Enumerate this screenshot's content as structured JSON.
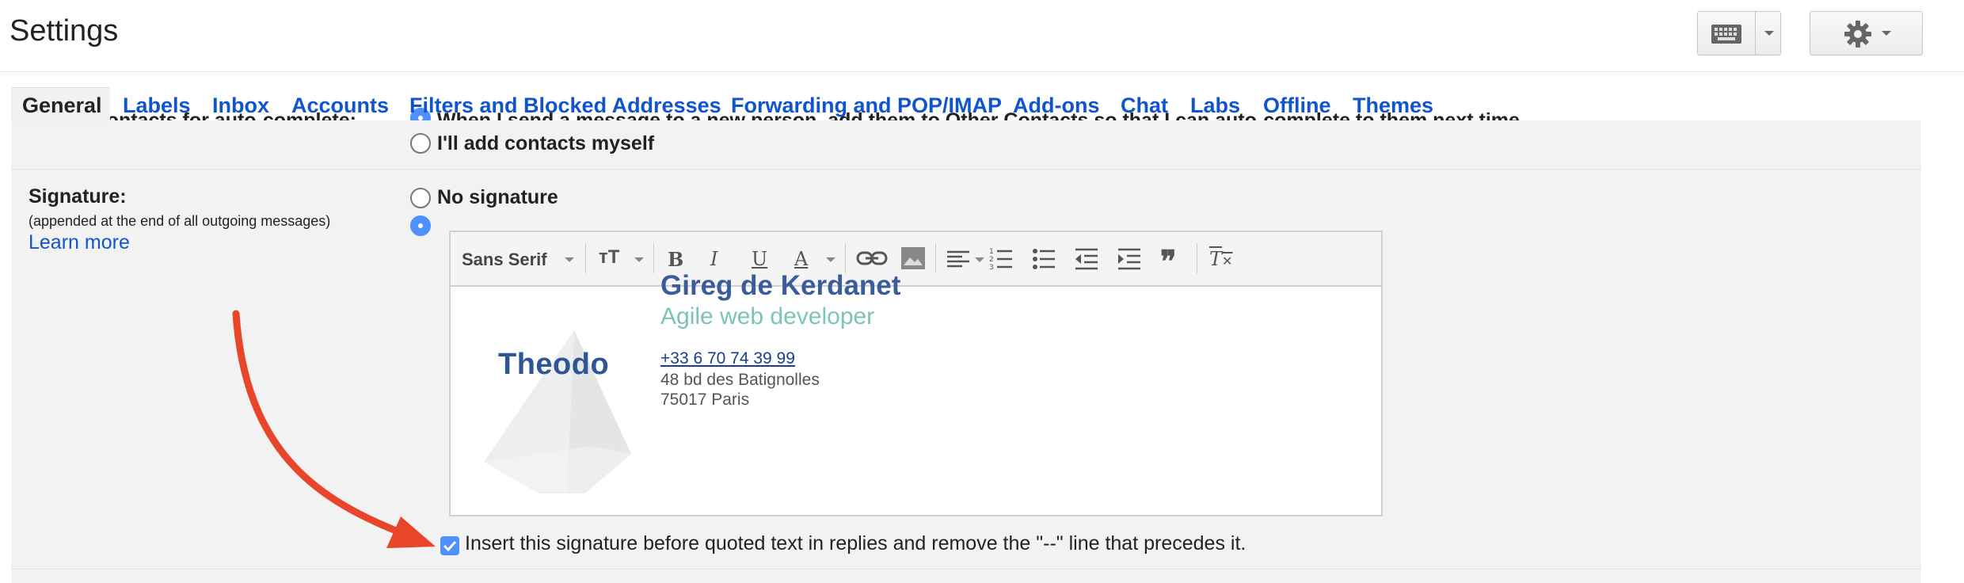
{
  "header": {
    "title": "Settings"
  },
  "tabs": [
    "General",
    "Labels",
    "Inbox",
    "Accounts",
    "Filters and Blocked Addresses",
    "Forwarding and POP/IMAP",
    "Add-ons",
    "Chat",
    "Labs",
    "Offline",
    "Themes"
  ],
  "contacts": {
    "cut_label": "Create contacts for auto-complete:",
    "cut_option": "When I send a message to a new person, add them to Other Contacts so that I can auto-complete to them next time",
    "option_manual": "I'll add contacts myself"
  },
  "signature": {
    "label": "Signature:",
    "sublabel": "(appended at the end of all outgoing messages)",
    "learn_more": "Learn more",
    "no_signature": "No signature",
    "font_name": "Sans Serif",
    "card": {
      "logo_text": "Theodo",
      "name": "Gireg de Kerdanet",
      "title": "Agile web developer",
      "phone": "+33 6 70 74 39 99",
      "address1": "48 bd des Batignolles",
      "address2": "75017 Paris"
    },
    "insert_before_quoted": "Insert this signature before quoted text in replies and remove the \"--\" line that precedes it.",
    "insert_checked": true
  },
  "colors": {
    "link": "#1155cc",
    "accent": "#4d90fe",
    "name": "#3b5b9a",
    "subtitle": "#7cc3b8",
    "arrow": "#e8452a"
  },
  "icons": [
    "keyboard-icon",
    "gear-icon",
    "bold-icon",
    "italic-icon",
    "underline-icon",
    "text-color-icon",
    "link-icon",
    "image-icon",
    "align-icon",
    "numbered-list-icon",
    "bulleted-list-icon",
    "indent-less-icon",
    "indent-more-icon",
    "quote-icon",
    "remove-formatting-icon",
    "arrow-annotation"
  ]
}
